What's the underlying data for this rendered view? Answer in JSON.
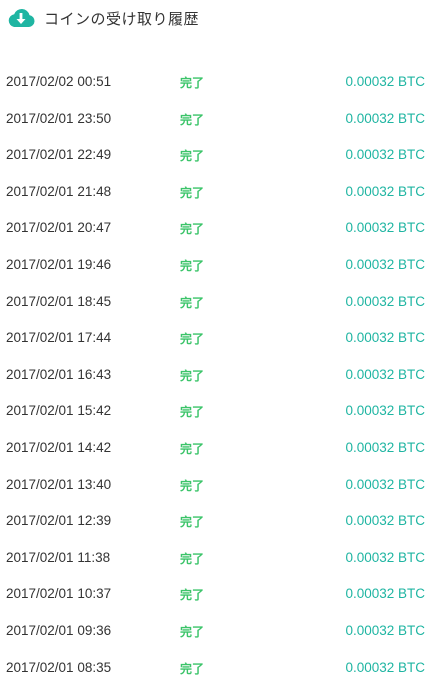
{
  "header": {
    "title": "コインの受け取り履歴",
    "icon": "cloud-download-icon",
    "icon_color": "#1fb5a2"
  },
  "colors": {
    "status": "#3cc46a",
    "amount": "#1fb5a2",
    "text": "#333333"
  },
  "rows": [
    {
      "date": "2017/02/02 00:51",
      "status": "完了",
      "amount": "0.00032 BTC"
    },
    {
      "date": "2017/02/01 23:50",
      "status": "完了",
      "amount": "0.00032 BTC"
    },
    {
      "date": "2017/02/01 22:49",
      "status": "完了",
      "amount": "0.00032 BTC"
    },
    {
      "date": "2017/02/01 21:48",
      "status": "完了",
      "amount": "0.00032 BTC"
    },
    {
      "date": "2017/02/01 20:47",
      "status": "完了",
      "amount": "0.00032 BTC"
    },
    {
      "date": "2017/02/01 19:46",
      "status": "完了",
      "amount": "0.00032 BTC"
    },
    {
      "date": "2017/02/01 18:45",
      "status": "完了",
      "amount": "0.00032 BTC"
    },
    {
      "date": "2017/02/01 17:44",
      "status": "完了",
      "amount": "0.00032 BTC"
    },
    {
      "date": "2017/02/01 16:43",
      "status": "完了",
      "amount": "0.00032 BTC"
    },
    {
      "date": "2017/02/01 15:42",
      "status": "完了",
      "amount": "0.00032 BTC"
    },
    {
      "date": "2017/02/01 14:42",
      "status": "完了",
      "amount": "0.00032 BTC"
    },
    {
      "date": "2017/02/01 13:40",
      "status": "完了",
      "amount": "0.00032 BTC"
    },
    {
      "date": "2017/02/01 12:39",
      "status": "完了",
      "amount": "0.00032 BTC"
    },
    {
      "date": "2017/02/01 11:38",
      "status": "完了",
      "amount": "0.00032 BTC"
    },
    {
      "date": "2017/02/01 10:37",
      "status": "完了",
      "amount": "0.00032 BTC"
    },
    {
      "date": "2017/02/01 09:36",
      "status": "完了",
      "amount": "0.00032 BTC"
    },
    {
      "date": "2017/02/01 08:35",
      "status": "完了",
      "amount": "0.00032 BTC"
    }
  ]
}
